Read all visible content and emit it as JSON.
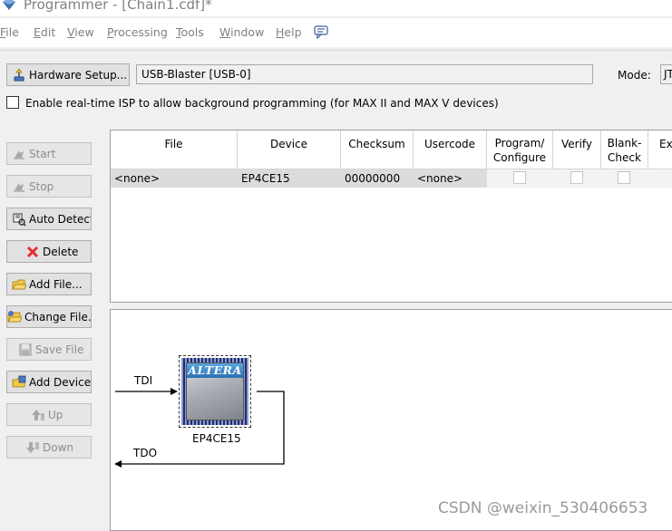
{
  "window": {
    "title": "Programmer - [Chain1.cdf]*"
  },
  "menu": [
    {
      "label": "File",
      "access_key": "F"
    },
    {
      "label": "Edit",
      "access_key": "E"
    },
    {
      "label": "View",
      "access_key": "V"
    },
    {
      "label": "Processing",
      "access_key": "P"
    },
    {
      "label": "Tools",
      "access_key": "T"
    },
    {
      "label": "Window",
      "access_key": "W"
    },
    {
      "label": "Help",
      "access_key": "H"
    }
  ],
  "hardware": {
    "setup_label": "Hardware Setup...",
    "selected": "USB-Blaster [USB-0]",
    "mode_label": "Mode:",
    "mode_value": "JTAG"
  },
  "isp": {
    "label": "Enable real-time ISP to allow background programming (for MAX II and MAX V devices)",
    "checked": false
  },
  "sidebar": {
    "start": "Start",
    "stop": "Stop",
    "auto_detect": "Auto Detect",
    "delete": "Delete",
    "add_file": "Add File...",
    "change_file": "Change File..",
    "save_file": "Save File",
    "add_device": "Add Device..",
    "up": "Up",
    "down": "Down"
  },
  "table": {
    "columns": [
      "File",
      "Device",
      "Checksum",
      "Usercode",
      "Program/\nConfigure",
      "Verify",
      "Blank-\nCheck",
      "Ex"
    ],
    "rows": [
      {
        "file": "<none>",
        "device": "EP4CE15",
        "checksum": "00000000",
        "usercode": "<none>",
        "program": false,
        "verify": false,
        "blank_check": false
      }
    ]
  },
  "chain": {
    "tdi": "TDI",
    "tdo": "TDO",
    "device": "EP4CE15",
    "logo_text": "ALTERA"
  },
  "watermark": "CSDN @weixin_530406653"
}
